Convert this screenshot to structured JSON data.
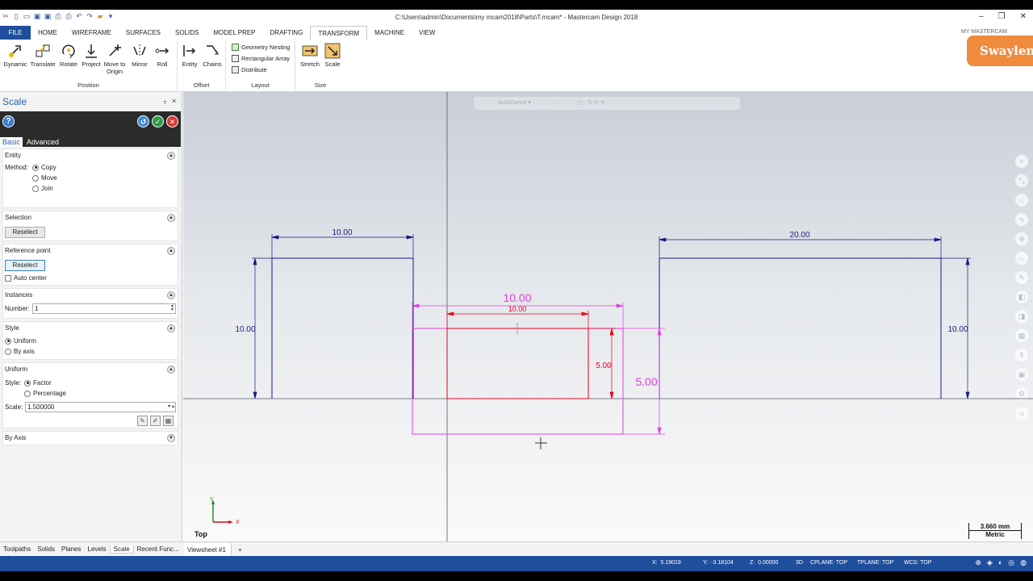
{
  "titlebar": {
    "title": "C:\\Users\\admin\\Documents\\my mcam2018\\Parts\\T.mcam* - Mastercam Design 2018",
    "buttons": [
      "–",
      "❐",
      "✕"
    ]
  },
  "tabs": [
    "FILE",
    "HOME",
    "WIREFRAME",
    "SURFACES",
    "SOLIDS",
    "MODEL PREP",
    "DRAFTING",
    "TRANSFORM",
    "MACHINE",
    "VIEW"
  ],
  "active_tab": "TRANSFORM",
  "my_mastercam": "MY MASTERCAM",
  "logo_text": "Swaylen",
  "ribbon": {
    "position": {
      "title": "Position",
      "buttons": [
        "Dynamic",
        "Translate",
        "Rotate",
        "Project",
        "Move to Origin",
        "Mirror",
        "Roll"
      ]
    },
    "offset": {
      "title": "Offset",
      "buttons": [
        "Entity",
        "Chains"
      ]
    },
    "layout": {
      "title": "Layout",
      "items": [
        "Geometry Nesting",
        "Rectangular Array",
        "Distribute"
      ]
    },
    "size": {
      "title": "Size",
      "buttons": [
        "Stretch",
        "Scale"
      ]
    }
  },
  "panel": {
    "title": "Scale",
    "tabs": [
      "Basic",
      "Advanced"
    ],
    "entity": {
      "header": "Entity",
      "method_label": "Method:",
      "methods": [
        "Copy",
        "Move",
        "Join"
      ],
      "selected": "Copy"
    },
    "selection": {
      "header": "Selection",
      "button": "Reselect"
    },
    "reference_point": {
      "header": "Reference point",
      "button": "Reselect",
      "auto_center": "Auto center"
    },
    "instances": {
      "header": "Instances",
      "number_label": "Number:",
      "number_value": "1"
    },
    "style": {
      "header": "Style",
      "options": [
        "Uniform",
        "By axis"
      ],
      "selected": "Uniform"
    },
    "uniform": {
      "header": "Uniform",
      "style_label": "Style:",
      "options": [
        "Factor",
        "Percentage"
      ],
      "selected": "Factor",
      "scale_label": "Scale:",
      "scale_value": "1.500000"
    },
    "by_axis": {
      "header": "By Axis"
    }
  },
  "viewport": {
    "dimensions": {
      "left_width": "10.00",
      "left_height": "10.00",
      "right_width": "20.00",
      "right_height": "10.00",
      "magenta_width": "10.00",
      "red_width": "10.00",
      "red_height": "5.00",
      "magenta_height": "5.00"
    },
    "toolbar_text": "AutoCursor",
    "view_label": "Top",
    "scale_value": "3.660 mm",
    "scale_unit": "Metric",
    "axis_x": "X",
    "axis_y": "Y",
    "colors": {
      "geometry": "#1a1a80",
      "preview": "#e8001c",
      "ghost": "#e040e0"
    }
  },
  "bottom_tabs": [
    "Toolpaths",
    "Solids",
    "Planes",
    "Levels",
    "Scale",
    "Recent Func..."
  ],
  "active_bottom_tab": "Scale",
  "viewsheet": {
    "label": "Viewsheet #1",
    "add": "+"
  },
  "status": {
    "x_label": "X:",
    "x_value": "5.19019",
    "y_label": "Y:",
    "y_value": "-3.18104",
    "z_label": "Z:",
    "z_value": "0.00000",
    "mode": "3D",
    "cplane": "CPLANE: TOP",
    "tplane": "TPLANE: TOP",
    "wcs": "WCS: TOP"
  }
}
